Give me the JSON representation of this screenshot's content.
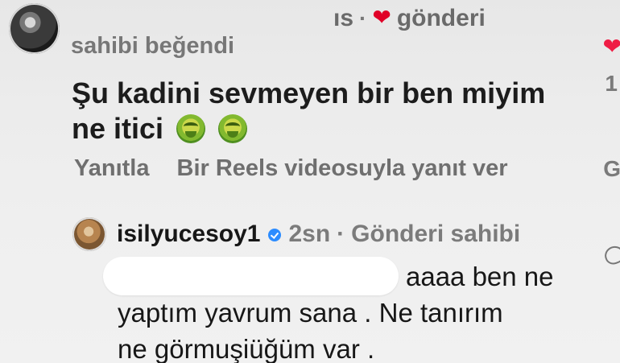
{
  "header": {
    "partial_text": "ıs",
    "separator": "·",
    "heart_icon": "heart-icon",
    "heart_color": "#e00027",
    "post_label": "gönderi"
  },
  "comment": {
    "liked_by_text": "sahibi beğendi",
    "text_line_1": "Şu kadini sevmeyen bir ben miyim",
    "text_line_2": "ne itici",
    "emoji_icon": "nauseated-face-icon",
    "actions": {
      "reply": "Yanıtla",
      "reels_reply": "Bir Reels videosuyla yanıt ver"
    }
  },
  "reply": {
    "username": "isilyucesoy1",
    "verified_icon": "verified-badge-icon",
    "time": "2sn",
    "separator": "·",
    "owner_label": "Gönderi sahibi",
    "line_1": "aaaa ben ne",
    "line_2": "yaptım yavrum sana . Ne tanırım",
    "line_3": "ne görmuşiüğüm var ."
  },
  "side": {
    "heart_icon": "heart-icon",
    "count_fragment": "1",
    "letter_fragment": "G",
    "outline_icon": "heart-outline-icon"
  }
}
